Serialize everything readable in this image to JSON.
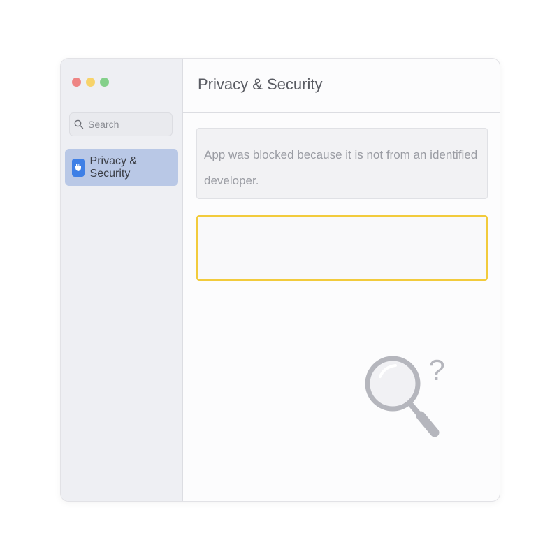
{
  "window": {
    "traffic_lights": [
      {
        "name": "close",
        "color": "#ee8584"
      },
      {
        "name": "minimize",
        "color": "#f7d36a"
      },
      {
        "name": "zoom",
        "color": "#84d08a"
      }
    ]
  },
  "sidebar": {
    "search": {
      "placeholder": "Search",
      "icon": "search-icon"
    },
    "items": [
      {
        "label": "Privacy & Security",
        "icon": "privacy-security-icon",
        "selected": true,
        "icon_color": "#3d7fe6"
      }
    ]
  },
  "main": {
    "title": "Privacy & Security",
    "notice": "App was blocked because it is not from an identified developer.",
    "empty_box_accent": "#f2cb3c",
    "illustration": {
      "icon": "magnifier-question-icon",
      "glyph": "?",
      "color": "#b5b6bd"
    }
  }
}
